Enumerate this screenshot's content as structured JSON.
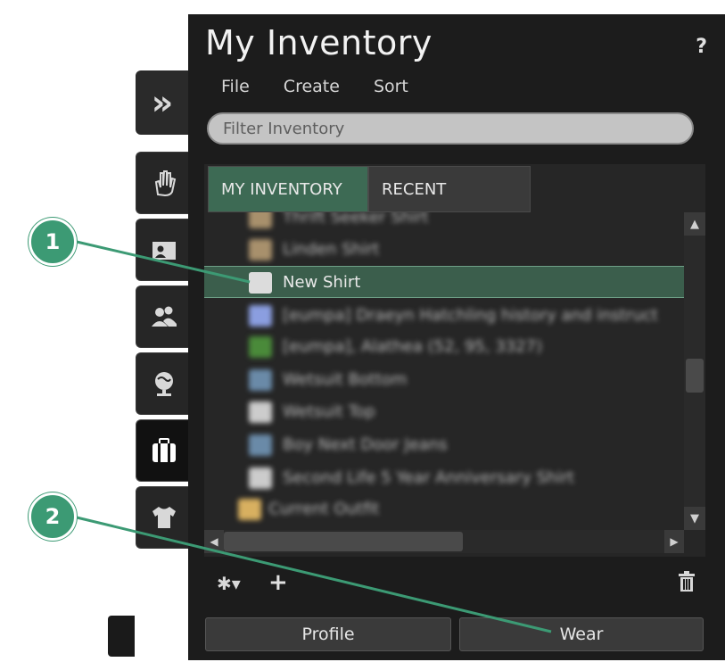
{
  "panel": {
    "title": "My Inventory",
    "help": "?",
    "menu": [
      "File",
      "Create",
      "Sort"
    ],
    "filter_placeholder": "Filter Inventory"
  },
  "tabs": [
    {
      "label": "MY INVENTORY",
      "active": true
    },
    {
      "label": "RECENT",
      "active": false
    }
  ],
  "items": [
    {
      "label": "Thrift Seeker Shirt",
      "icon": "shirt-icon",
      "color": "#a8906c",
      "blurred": true
    },
    {
      "label": "Linden Shirt",
      "icon": "shirt-icon",
      "color": "#a8906c",
      "blurred": true
    },
    {
      "label": "New Shirt",
      "icon": "shirt-icon",
      "color": "#dcdcdc",
      "blurred": false,
      "selected": true
    },
    {
      "label": "[eumpa] Draeyn Hatchling history and instruct",
      "icon": "notecard-icon",
      "color": "#8b9ee0",
      "blurred": true
    },
    {
      "label": "[eumpa], Alathea (52, 95, 3327)",
      "icon": "landmark-icon",
      "color": "#4a8a3a",
      "blurred": true
    },
    {
      "label": "Wetsuit Bottom",
      "icon": "pants-icon",
      "color": "#6a8aa8",
      "blurred": true
    },
    {
      "label": "Wetsuit Top",
      "icon": "shirt-icon",
      "color": "#cccccc",
      "blurred": true
    },
    {
      "label": "Boy Next Door Jeans",
      "icon": "pants-icon",
      "color": "#6a8aa8",
      "blurred": true
    },
    {
      "label": "Second Life 5 Year Anniversary Shirt",
      "icon": "shirt-icon",
      "color": "#cccccc",
      "blurred": true
    },
    {
      "label": "Current Outfit",
      "icon": "folder-icon",
      "color": "#d8b060",
      "blurred": true
    }
  ],
  "buttons": {
    "profile": "Profile",
    "wear": "Wear"
  },
  "callouts": [
    "1",
    "2"
  ],
  "colors": {
    "accent": "#3c9a74",
    "selection": "#3b5e4c",
    "panel_bg": "#1c1c1c"
  }
}
